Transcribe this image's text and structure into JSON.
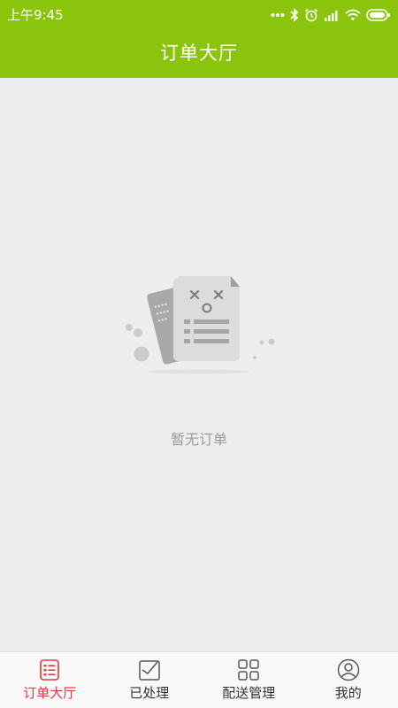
{
  "status_bar": {
    "time": "上午9:45",
    "icons": [
      "more-dots-icon",
      "bluetooth-icon",
      "alarm-icon",
      "signal-icon",
      "wifi-icon",
      "battery-icon"
    ]
  },
  "header": {
    "title": "订单大厅"
  },
  "main": {
    "empty_state_icon": "empty-document-icon",
    "empty_message": "暂无订单"
  },
  "tab_bar": {
    "tabs": [
      {
        "label": "订单大厅",
        "icon": "order-list-icon",
        "active": true
      },
      {
        "label": "已处理",
        "icon": "processed-icon",
        "active": false
      },
      {
        "label": "配送管理",
        "icon": "grid-icon",
        "active": false
      },
      {
        "label": "我的",
        "icon": "user-icon",
        "active": false
      }
    ]
  },
  "colors": {
    "header": "#8bc40d",
    "background": "#eeedef",
    "active_tab": "#e2383c",
    "inactive_tab": "#333333"
  }
}
